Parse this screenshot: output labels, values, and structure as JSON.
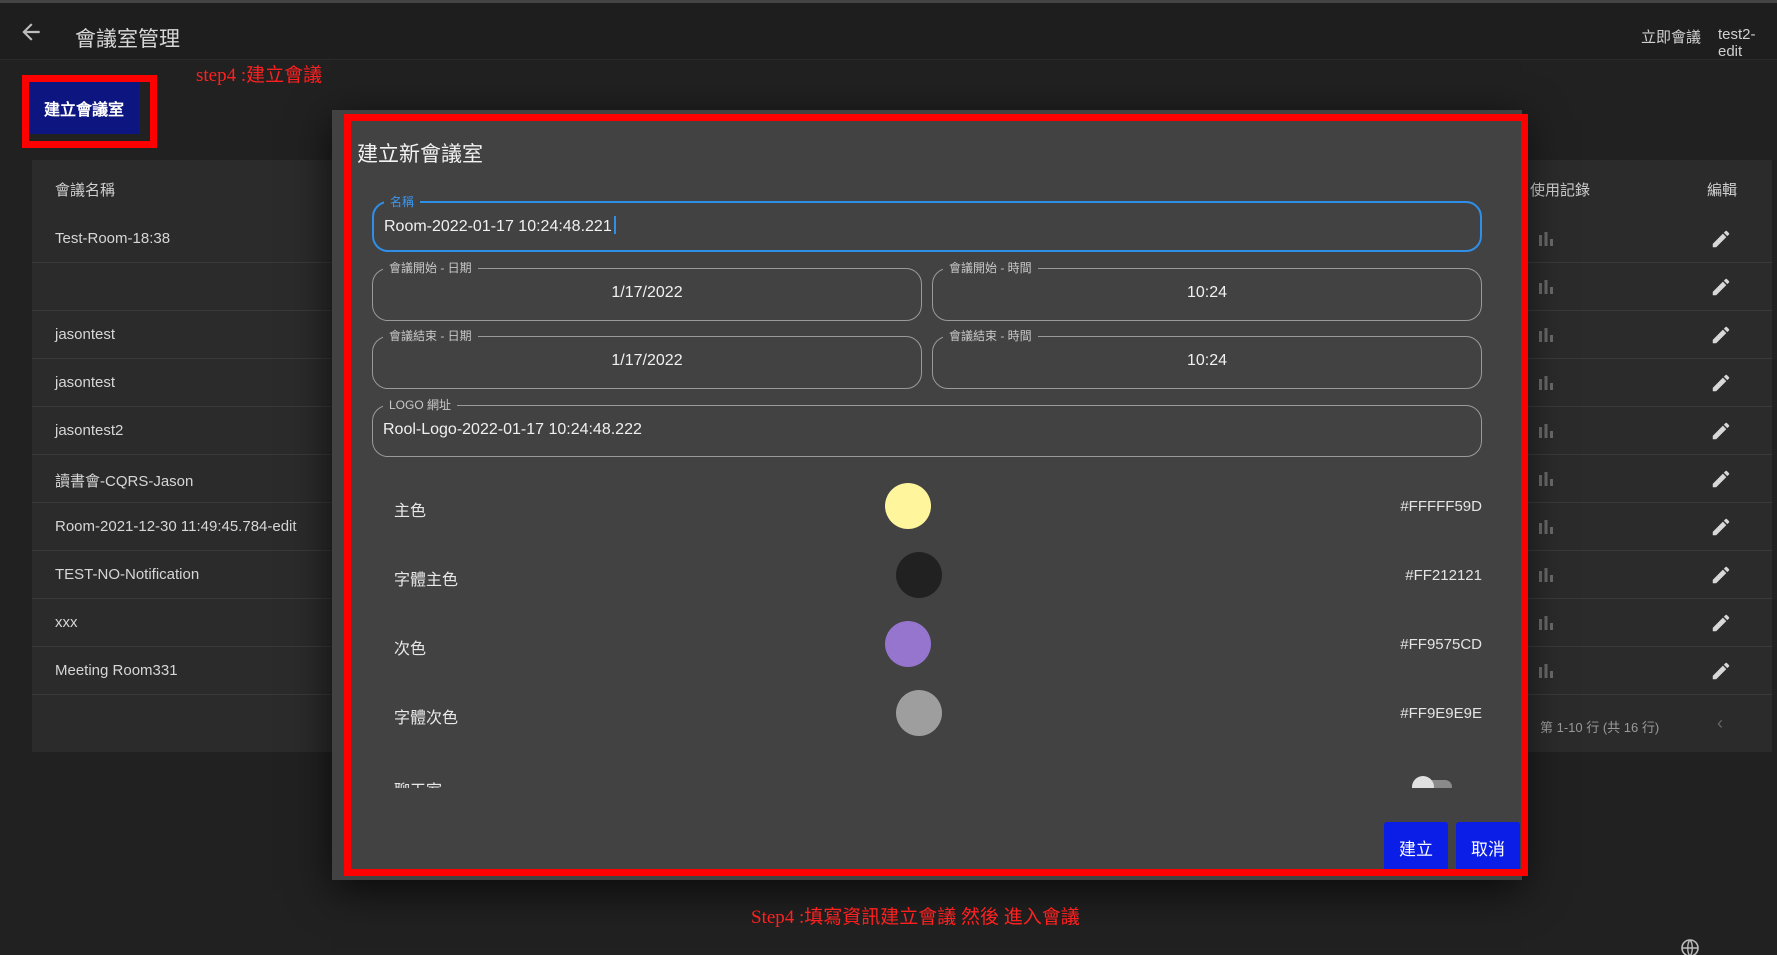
{
  "header": {
    "title": "會議室管理",
    "instant_meeting": "立即會議",
    "user": "test2-edit"
  },
  "toolbar": {
    "create_room_label": "建立會議室"
  },
  "annotations": {
    "step_top": "step4 :建立會議",
    "step_bottom": "Step4 :填寫資訊建立會議 然後 進入會議"
  },
  "table": {
    "columns": {
      "name": "會議名稱",
      "usage": "使用記錄",
      "edit": "編輯"
    },
    "rows": [
      {
        "name": "Test-Room-18:38"
      },
      {
        "name": ""
      },
      {
        "name": "jasontest"
      },
      {
        "name": "jasontest"
      },
      {
        "name": "jasontest2"
      },
      {
        "name": "讀書會-CQRS-Jason"
      },
      {
        "name": "Room-2021-12-30 11:49:45.784-edit"
      },
      {
        "name": "TEST-NO-Notification"
      },
      {
        "name": "xxx"
      },
      {
        "name": "Meeting Room331"
      }
    ],
    "pagination": "第 1-10 行 (共 16 行)",
    "prev_icon": "chevron-left-icon",
    "row_icons": {
      "usage": "bar-chart-icon",
      "edit": "pencil-icon"
    }
  },
  "dialog": {
    "title": "建立新會議室",
    "name_field": {
      "label": "名稱",
      "value": "Room-2022-01-17 10:24:48.221"
    },
    "start_date": {
      "label": "會議開始 - 日期",
      "value": "1/17/2022"
    },
    "start_time": {
      "label": "會議開始 - 時間",
      "value": "10:24"
    },
    "end_date": {
      "label": "會議結束 - 日期",
      "value": "1/17/2022"
    },
    "end_time": {
      "label": "會議結束 - 時間",
      "value": "10:24"
    },
    "logo_field": {
      "label": "LOGO 網址",
      "value": "Rool-Logo-2022-01-17 10:24:48.222"
    },
    "colors": [
      {
        "label": "主色",
        "hex": "#FFFFF59D",
        "color": "#fff59d"
      },
      {
        "label": "字體主色",
        "hex": "#FF212121",
        "color": "#212121"
      },
      {
        "label": "次色",
        "hex": "#FF9575CD",
        "color": "#9575cd"
      },
      {
        "label": "字體次色",
        "hex": "#FF9E9E9E",
        "color": "#9e9e9e"
      }
    ],
    "toggle": {
      "label": "聊天室",
      "enabled": false
    },
    "create_label": "建立",
    "cancel_label": "取消"
  },
  "accent_colors": {
    "primary_button": "#0a1ee8",
    "annotation": "#ff0000",
    "focus": "#2f8fe8"
  }
}
